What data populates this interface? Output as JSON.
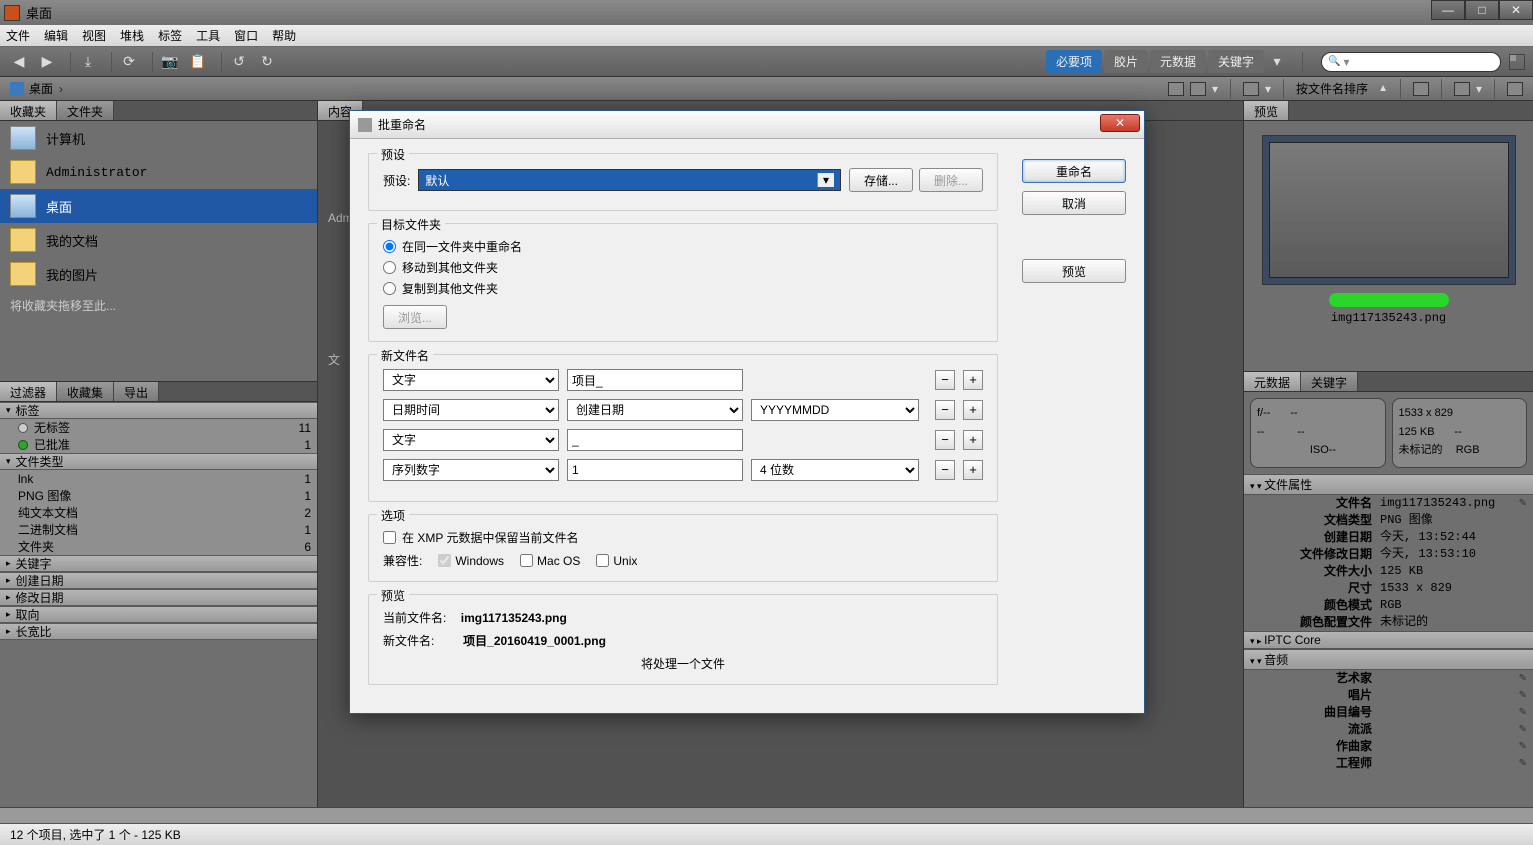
{
  "window": {
    "title": "桌面"
  },
  "menubar": [
    "文件",
    "编辑",
    "视图",
    "堆栈",
    "标签",
    "工具",
    "窗口",
    "帮助"
  ],
  "workspace_tabs": {
    "active": "必要项",
    "items": [
      "必要项",
      "胶片",
      "元数据",
      "关键字"
    ]
  },
  "search": {
    "placeholder": ""
  },
  "pathbar": {
    "location": "桌面",
    "sort_label": "按文件名排序"
  },
  "left": {
    "tabs": [
      "收藏夹",
      "文件夹"
    ],
    "favorites": [
      {
        "label": "计算机",
        "kind": "computer"
      },
      {
        "label": "Administrator",
        "kind": "folder"
      },
      {
        "label": "桌面",
        "kind": "computer",
        "selected": true
      },
      {
        "label": "我的文档",
        "kind": "folder"
      },
      {
        "label": "我的图片",
        "kind": "folder"
      }
    ],
    "drag_hint": "将收藏夹拖移至此..."
  },
  "filter": {
    "tabs": [
      "过滤器",
      "收藏集",
      "导出"
    ],
    "sections": [
      {
        "title": "标签",
        "open": true,
        "rows": [
          {
            "dot": "none",
            "label": "无标签",
            "count": 11
          },
          {
            "dot": "green",
            "label": "已批准",
            "count": 1
          }
        ]
      },
      {
        "title": "文件类型",
        "open": true,
        "rows": [
          {
            "label": "lnk",
            "count": 1
          },
          {
            "label": "PNG 图像",
            "count": 1
          },
          {
            "label": "纯文本文档",
            "count": 2
          },
          {
            "label": "二进制文档",
            "count": 1
          },
          {
            "label": "文件夹",
            "count": 6
          }
        ]
      },
      {
        "title": "关键字",
        "open": false
      },
      {
        "title": "创建日期",
        "open": false
      },
      {
        "title": "修改日期",
        "open": false
      },
      {
        "title": "取向",
        "open": false
      },
      {
        "title": "长宽比",
        "open": false
      }
    ]
  },
  "center": {
    "tab_label": "内容",
    "shadow_label_1": "Admi",
    "shadow_label_2": "文"
  },
  "right": {
    "preview_tab": "预览",
    "preview_filename": "img117135243.png",
    "meta_tabs": [
      "元数据",
      "关键字"
    ],
    "summary_left": {
      "f": "f/--",
      "exp": "--",
      "wb": "--",
      "ev": "--",
      "iso": "ISO--"
    },
    "summary_right": {
      "dims": "1533 x 829",
      "size": "125 KB",
      "dash": "--",
      "tag": "未标记的",
      "cs": "RGB"
    },
    "sections": {
      "file_props": {
        "title": "文件属性",
        "rows": [
          {
            "k": "文件名",
            "v": "img117135243.png",
            "edit": true
          },
          {
            "k": "文档类型",
            "v": "PNG 图像"
          },
          {
            "k": "创建日期",
            "v": "今天, 13:52:44"
          },
          {
            "k": "文件修改日期",
            "v": "今天, 13:53:10"
          },
          {
            "k": "文件大小",
            "v": "125 KB"
          },
          {
            "k": "尺寸",
            "v": "1533 x 829"
          },
          {
            "k": "颜色模式",
            "v": "RGB"
          },
          {
            "k": "颜色配置文件",
            "v": "未标记的"
          }
        ]
      },
      "iptc": {
        "title": "IPTC Core"
      },
      "audio": {
        "title": "音频",
        "rows": [
          {
            "k": "艺术家",
            "v": "",
            "edit": true
          },
          {
            "k": "唱片",
            "v": "",
            "edit": true
          },
          {
            "k": "曲目编号",
            "v": "",
            "edit": true
          },
          {
            "k": "流派",
            "v": "",
            "edit": true
          },
          {
            "k": "作曲家",
            "v": "",
            "edit": true
          },
          {
            "k": "工程师",
            "v": "",
            "edit": true
          }
        ]
      }
    }
  },
  "status": {
    "text": "12 个项目, 选中了 1 个 - 125 KB"
  },
  "dialog": {
    "title": "批重命名",
    "buttons": {
      "rename": "重命名",
      "cancel": "取消",
      "preview": "预览"
    },
    "preset": {
      "group_label": "预设",
      "label": "预设:",
      "value": "默认",
      "save": "存储...",
      "delete": "删除..."
    },
    "target": {
      "group_label": "目标文件夹",
      "opt_same": "在同一文件夹中重命名",
      "opt_move": "移动到其他文件夹",
      "opt_copy": "复制到其他文件夹",
      "browse": "浏览..."
    },
    "newname": {
      "group_label": "新文件名",
      "rows": [
        {
          "type": "文字",
          "val": "项目_"
        },
        {
          "type": "日期时间",
          "sub": "创建日期",
          "fmt": "YYYYMMDD"
        },
        {
          "type": "文字",
          "val": "_"
        },
        {
          "type": "序列数字",
          "val": "1",
          "digits": "4 位数"
        }
      ]
    },
    "options": {
      "group_label": "选项",
      "xmp": "在 XMP 元数据中保留当前文件名",
      "compat_label": "兼容性:",
      "win": "Windows",
      "mac": "Mac OS",
      "unix": "Unix"
    },
    "preview_group": {
      "group_label": "预览",
      "current_label": "当前文件名:",
      "current_value": "img117135243.png",
      "new_label": "新文件名:",
      "new_value": "项目_20160419_0001.png",
      "note": "将处理一个文件"
    }
  }
}
